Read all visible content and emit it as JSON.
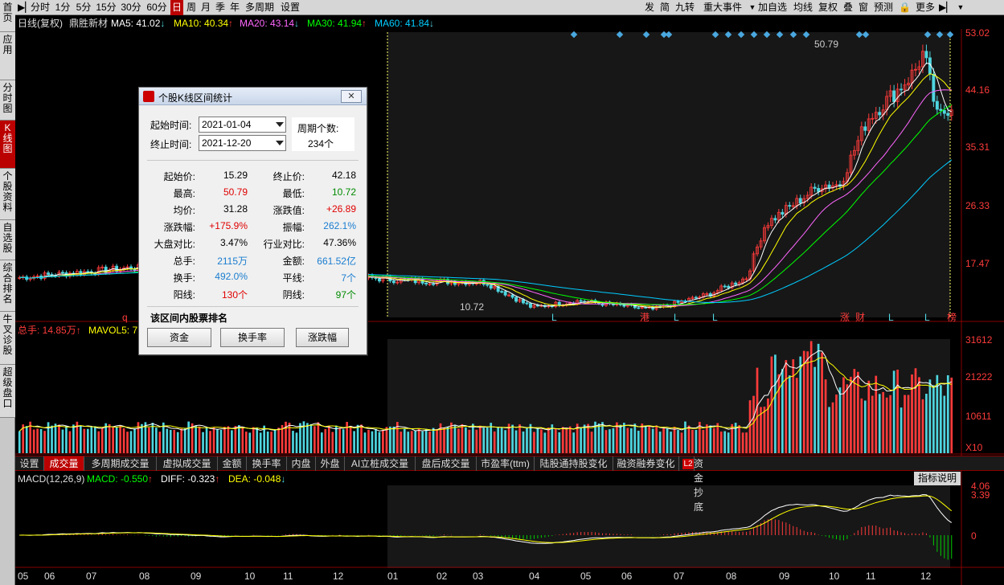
{
  "toolbar": {
    "periods": [
      "分时",
      "1分",
      "5分",
      "15分",
      "30分",
      "60分",
      "日",
      "周",
      "月",
      "季",
      "年",
      "多周期",
      "设置"
    ],
    "right": [
      "发",
      "简",
      "九转",
      "重大事件",
      "加自选",
      "均线",
      "复权",
      "叠",
      "窗",
      "预测",
      "更多"
    ]
  },
  "sidebar": [
    "首页",
    "应用",
    "分时图",
    "K线图",
    "个股资料",
    "自选股",
    "综合排名",
    "牛叉诊股",
    "超级盘口"
  ],
  "chart_header": {
    "title": "日线(复权)",
    "stock": "鼎胜新材",
    "ma5": "MA5: 41.02",
    "ma10": "MA10: 40.34",
    "ma20": "MA20: 43.14",
    "ma30": "MA30: 41.94",
    "ma60": "MA60: 41.84",
    "up": "↑",
    "down": "↓"
  },
  "price_axis": [
    "53.02",
    "44.16",
    "35.31",
    "26.33",
    "17.47"
  ],
  "annotations": {
    "high": "50.79",
    "low": "10.72",
    "q": "q",
    "markers": [
      "L",
      "港",
      "L",
      "L",
      "L",
      "涨",
      "财",
      "L",
      "L",
      "榜"
    ]
  },
  "vol_header": {
    "label": "总手: 14.85万",
    "mavol": "MAVOL5: 7"
  },
  "vol_axis": [
    "31612",
    "21222",
    "10611",
    "X10"
  ],
  "indicator_tabs": [
    "设置",
    "成交量",
    "多周期成交量",
    "虚拟成交量",
    "金额",
    "换手率",
    "内盘",
    "外盘",
    "AI立桩成交量",
    "盘后成交量",
    "市盈率(ttm)",
    "陆股通持股变化",
    "融资融券变化",
    "资金抄底"
  ],
  "l2": "L2",
  "macd_header": {
    "name": "MACD(12,26,9)",
    "macd": "MACD: -0.550",
    "diff": "DIFF: -0.323",
    "dea": "DEA: -0.048",
    "explain": "指标说明"
  },
  "macd_axis": [
    "4.06",
    "3.39",
    "0"
  ],
  "months": [
    "05",
    "06",
    "07",
    "08",
    "09",
    "10",
    "11",
    "12",
    "01",
    "02",
    "03",
    "04",
    "05",
    "06",
    "07",
    "08",
    "09",
    "10",
    "11",
    "12"
  ],
  "dialog": {
    "title": "个股K线区间统计",
    "start_label": "起始时间:",
    "start": "2021-01-04",
    "end_label": "终止时间:",
    "end": "2021-12-20",
    "period_label": "周期个数:",
    "period": "234个",
    "rows": [
      [
        "起始价:",
        "15.29",
        "终止价:",
        "42.18"
      ],
      [
        "最高:",
        "50.79",
        "最低:",
        "10.72"
      ],
      [
        "均价:",
        "31.28",
        "涨跌值:",
        "+26.89"
      ],
      [
        "涨跌幅:",
        "+175.9%",
        "振幅:",
        "262.1%"
      ],
      [
        "大盘对比:",
        "3.47%",
        "行业对比:",
        "47.36%"
      ],
      [
        "总手:",
        "2115万",
        "金额:",
        "661.52亿"
      ],
      [
        "换手:",
        "492.0%",
        "平线:",
        "7个"
      ],
      [
        "阳线:",
        "130个",
        "阴线:",
        "97个"
      ]
    ],
    "rank_title": "该区间内股票排名",
    "buttons": [
      "资金",
      "换手率",
      "涨跌幅"
    ]
  },
  "colors": {
    "up": "#ff3b3b",
    "down": "#4fd6e0",
    "ma5": "#ffffff",
    "ma10": "#ffff00",
    "ma20": "#ff66ff",
    "ma30": "#00ff00",
    "ma60": "#00ccff"
  }
}
